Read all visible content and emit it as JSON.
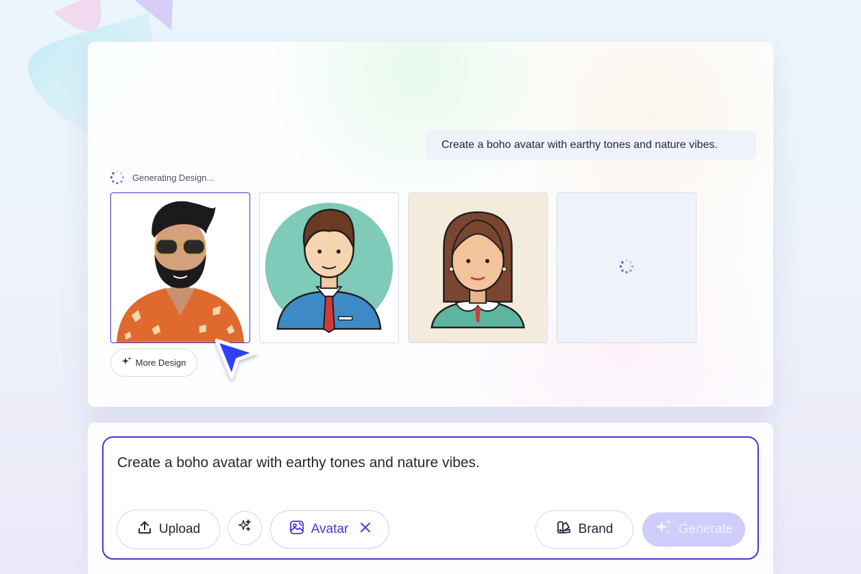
{
  "colors": {
    "accent": "#4733d2",
    "generate_bg": "#cfcdfb",
    "loading_bg": "#eff2fb"
  },
  "preview": {
    "prompt_bubble": "Create a boho avatar with earthy tones and nature vibes.",
    "status_text": "Generating Design...",
    "thumbnails": [
      {
        "name": "avatar-man-sunglasses",
        "state": "selected"
      },
      {
        "name": "avatar-man-tie",
        "state": "done"
      },
      {
        "name": "avatar-woman-collar",
        "state": "done"
      },
      {
        "name": "avatar-loading",
        "state": "loading"
      }
    ],
    "more_design_label": "More Design"
  },
  "composer": {
    "input_value": "Create a boho avatar with earthy tones and nature vibes.",
    "upload_label": "Upload",
    "tag_label": "Avatar",
    "brand_label": "Brand",
    "generate_label": "Generate"
  },
  "icons": [
    "spinner-icon",
    "sparkle-icon",
    "upload-icon",
    "magic-wand-icon",
    "image-edit-icon",
    "close-icon",
    "brand-palette-icon",
    "cursor-arrow-icon"
  ]
}
